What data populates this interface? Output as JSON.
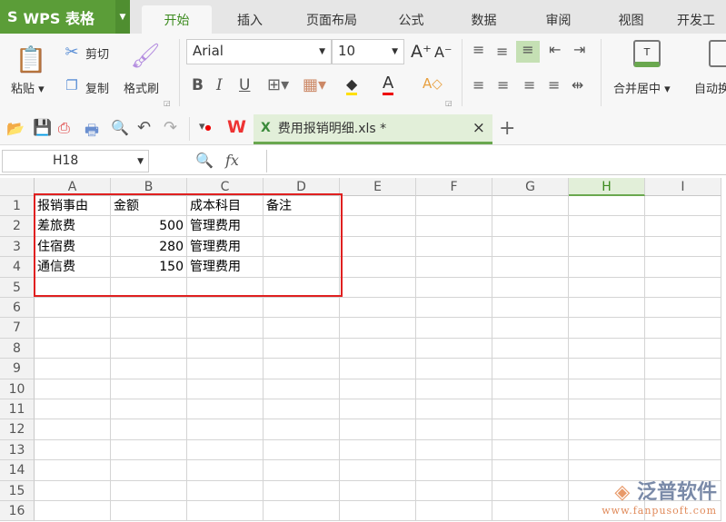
{
  "app": {
    "title": "WPS 表格"
  },
  "tabs": [
    "开始",
    "插入",
    "页面布局",
    "公式",
    "数据",
    "审阅",
    "视图",
    "开发工"
  ],
  "ribbon": {
    "paste": "粘贴",
    "cut": "剪切",
    "copy": "复制",
    "format_painter": "格式刷",
    "font": "Arial",
    "size": "10",
    "bold": "B",
    "italic": "I",
    "underline": "U",
    "merge": "合并居中",
    "autowrap": "自动换"
  },
  "document": {
    "tab_title": "费用报销明细.xls *",
    "close": "×",
    "new_tab": "+"
  },
  "formula_bar": {
    "name_box": "H18",
    "fx": "fx",
    "value": ""
  },
  "sheet": {
    "columns": [
      "A",
      "B",
      "C",
      "D",
      "E",
      "F",
      "G",
      "H",
      "I"
    ],
    "selected_column": "H",
    "rows": [
      "1",
      "2",
      "3",
      "4",
      "5",
      "6",
      "7",
      "8",
      "9",
      "10",
      "11",
      "12",
      "13",
      "14",
      "15",
      "16"
    ],
    "cells": [
      [
        "报销事由",
        "金额",
        "成本科目",
        "备注"
      ],
      [
        "差旅费",
        "500",
        "管理费用",
        ""
      ],
      [
        "住宿费",
        "280",
        "管理费用",
        ""
      ],
      [
        "通信费",
        "150",
        "管理费用",
        ""
      ]
    ]
  },
  "watermark": {
    "brand": "泛普软件",
    "url": "www.fanpusoft.com"
  },
  "colors": {
    "accent": "#5b9d38",
    "highlight": "#e02020"
  }
}
